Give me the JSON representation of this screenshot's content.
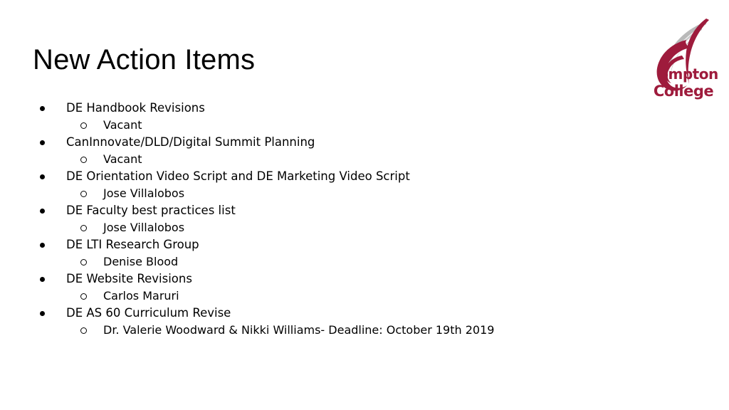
{
  "slide": {
    "title": "New Action Items",
    "background_color": "#ffffff",
    "text_color": "#000000"
  },
  "logo": {
    "name": "compton-college-logo",
    "word_top": "ompton",
    "word_bottom": "College",
    "maroon": "#9e1b3c",
    "gray": "#b9b9b9"
  },
  "content": {
    "items": [
      {
        "level": 1,
        "text": "DE Handbook Revisions"
      },
      {
        "level": 2,
        "text": "Vacant"
      },
      {
        "level": 1,
        "text": "CanInnovate/DLD/Digital Summit Planning"
      },
      {
        "level": 2,
        "text": "Vacant"
      },
      {
        "level": 1,
        "text": "DE Orientation Video Script and DE Marketing Video Script"
      },
      {
        "level": 2,
        "text": "Jose Villalobos"
      },
      {
        "level": 1,
        "text": "DE Faculty best practices list"
      },
      {
        "level": 2,
        "text": "Jose Villalobos"
      },
      {
        "level": 1,
        "text": "DE LTI Research Group"
      },
      {
        "level": 2,
        "text": "Denise Blood"
      },
      {
        "level": 1,
        "text": "DE Website Revisions"
      },
      {
        "level": 2,
        "text": "Carlos Maruri"
      },
      {
        "level": 1,
        "text": "DE AS 60 Curriculum Revise"
      },
      {
        "level": 2,
        "text": "Dr. Valerie Woodward & Nikki Williams- Deadline: October 19th 2019"
      }
    ]
  }
}
